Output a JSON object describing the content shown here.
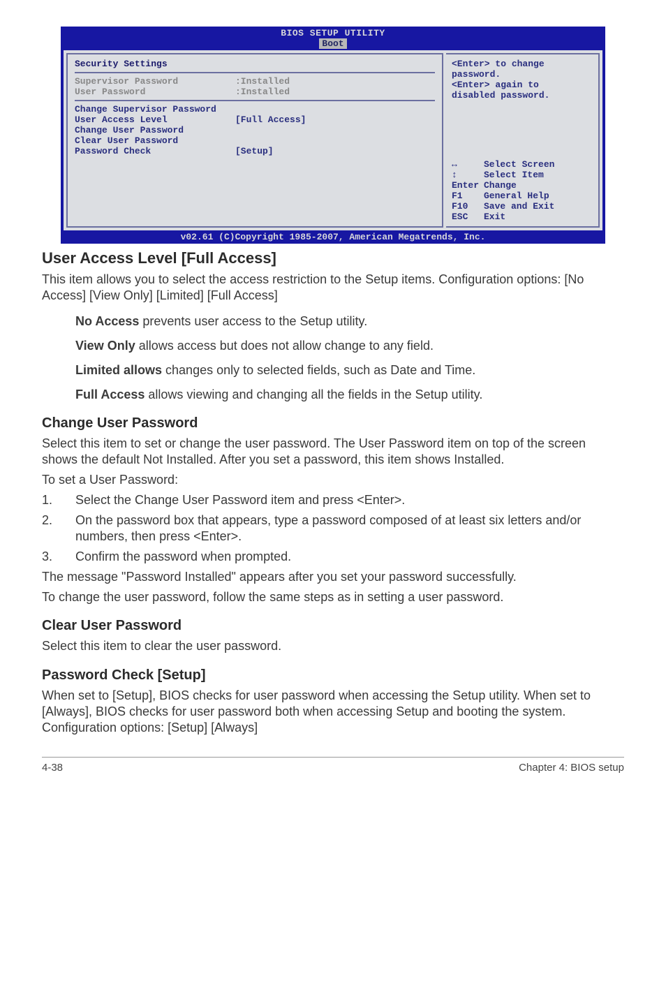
{
  "bios": {
    "title": "BIOS SETUP UTILITY",
    "tab": "Boot",
    "section": "Security Settings",
    "supPassLabel": "Supervisor Password",
    "supPassVal": ":Installed",
    "userPassLabel": "User Password",
    "userPassVal": ":Installed",
    "items": {
      "changeSup": "Change Supervisor Password",
      "userAccess": "User Access Level",
      "userAccessVal": "[Full Access]",
      "changeUser": "Change User Password",
      "clearUser": "Clear User Password",
      "passCheck": "Password Check",
      "passCheckVal": "[Setup]"
    },
    "help": {
      "l1": "<Enter> to change",
      "l2": "password.",
      "l3": "<Enter> again to",
      "l4": "disabled password."
    },
    "nav": {
      "selectScreen": "Select Screen",
      "selectItem": "Select Item",
      "enter": "Enter",
      "change": "Change",
      "f1": "F1",
      "general": "General Help",
      "f10": "F10",
      "save": "Save and Exit",
      "esc": "ESC",
      "exit": "Exit"
    },
    "footer": "v02.61 (C)Copyright 1985-2007, American Megatrends, Inc."
  },
  "sec1": {
    "title": "User Access Level [Full Access]",
    "p1": "This item allows you to select the access restriction to the Setup items. Configuration options: [No Access] [View Only] [Limited] [Full Access]",
    "no_b": "No Access",
    "no_t": " prevents user access to the Setup utility.",
    "view_b": "View Only",
    "view_t": " allows access but does not allow change to any field.",
    "lim_b": "Limited allows",
    "lim_t": " changes only to selected fields, such as Date and Time.",
    "full_b": "Full Access",
    "full_t": " allows viewing and changing all the fields in the Setup utility."
  },
  "sec2": {
    "title": "Change User Password",
    "p1": "Select this item to set or change the user password. The User Password item on top of the screen shows the default Not Installed. After you set a password, this item shows Installed.",
    "p2": "To set a User Password:",
    "s1": "Select the Change User Password item and press <Enter>.",
    "s2": "On the password box that appears, type a password composed of at least six letters and/or numbers, then press <Enter>.",
    "s3": "Confirm the password when prompted.",
    "p3": "The message \"Password Installed\" appears after you set your password successfully.",
    "p4": "To change the user password, follow the same steps as in setting a user password."
  },
  "sec3": {
    "title": "Clear User Password",
    "p1": "Select this item to clear the user password."
  },
  "sec4": {
    "title": "Password Check [Setup]",
    "p1": "When set to [Setup], BIOS checks for user password when accessing the Setup utility. When set to [Always], BIOS checks for user password both when accessing Setup and booting the system. Configuration options: [Setup] [Always]"
  },
  "footer": {
    "left": "4-38",
    "right": "Chapter 4: BIOS setup"
  }
}
